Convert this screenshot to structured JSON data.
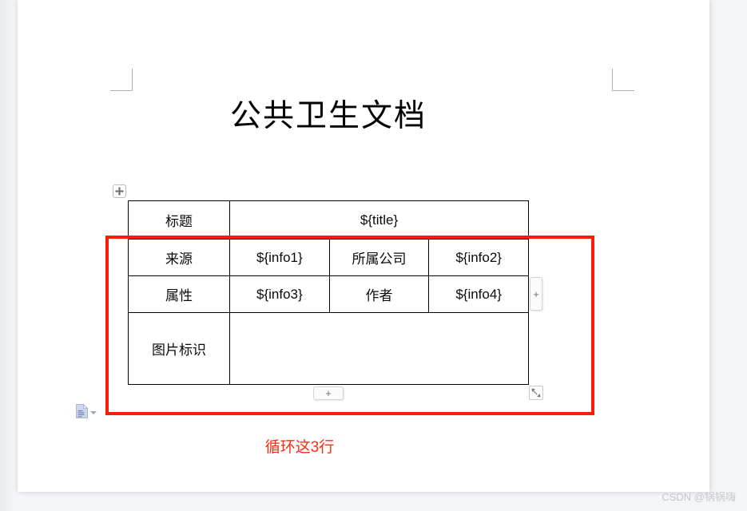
{
  "document": {
    "title": "公共卫生文档",
    "table": {
      "rows": [
        {
          "kind": "header",
          "cells": [
            {
              "text": "标题",
              "colspan": 1,
              "role": "label"
            },
            {
              "text": "${title}",
              "colspan": 3,
              "role": "value"
            }
          ]
        },
        {
          "kind": "data",
          "cells": [
            {
              "text": "来源",
              "colspan": 1,
              "role": "label"
            },
            {
              "text": "${info1}",
              "colspan": 1,
              "role": "value"
            },
            {
              "text": "所属公司",
              "colspan": 1,
              "role": "label"
            },
            {
              "text": "${info2}",
              "colspan": 1,
              "role": "value"
            }
          ]
        },
        {
          "kind": "data",
          "cells": [
            {
              "text": "属性",
              "colspan": 1,
              "role": "label"
            },
            {
              "text": "${info3}",
              "colspan": 1,
              "role": "value"
            },
            {
              "text": "作者",
              "colspan": 1,
              "role": "label"
            },
            {
              "text": "${info4}",
              "colspan": 1,
              "role": "value"
            }
          ]
        },
        {
          "kind": "image",
          "cells": [
            {
              "text": "图片标识",
              "colspan": 1,
              "role": "label"
            },
            {
              "text": "",
              "colspan": 3,
              "role": "value"
            }
          ]
        }
      ]
    }
  },
  "annotation": {
    "note": "循环这3行",
    "color": "#ff2a12",
    "box_color": "#fc1c08"
  },
  "widgets": {
    "move_handle_icon": "move-cross-icon",
    "add_column_label": "+",
    "add_row_label": "+",
    "resize_handle_icon": "resize-diagonal-icon",
    "paste_options_icon": "paste-options-icon",
    "paste_options_caret": "chevron-down-icon"
  },
  "watermark": {
    "text": "CSDN @锅锅嗨"
  }
}
